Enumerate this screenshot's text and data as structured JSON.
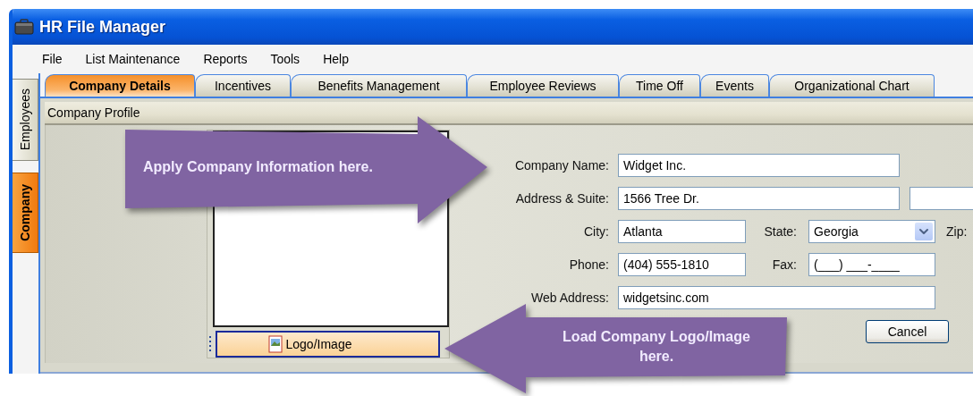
{
  "window": {
    "title": "HR File Manager"
  },
  "menu": [
    "File",
    "List Maintenance",
    "Reports",
    "Tools",
    "Help"
  ],
  "side_tabs": [
    {
      "label": "Employees",
      "selected": false
    },
    {
      "label": "Company",
      "selected": true
    }
  ],
  "tabs": [
    {
      "label": "Company Details",
      "selected": true
    },
    {
      "label": "Incentives",
      "selected": false
    },
    {
      "label": "Benefits Management",
      "selected": false
    },
    {
      "label": "Employee Reviews",
      "selected": false
    },
    {
      "label": "Time Off",
      "selected": false
    },
    {
      "label": "Events",
      "selected": false
    },
    {
      "label": "Organizational Chart",
      "selected": false
    }
  ],
  "section": {
    "title": "Company Profile"
  },
  "logo_button": {
    "label": "Logo/Image"
  },
  "form": {
    "company_name": {
      "label": "Company Name:",
      "value": "Widget Inc."
    },
    "address": {
      "label": "Address & Suite:",
      "value": "1566 Tree Dr."
    },
    "city": {
      "label": "City:",
      "value": "Atlanta"
    },
    "state": {
      "label": "State:",
      "value": "Georgia"
    },
    "zip": {
      "label": "Zip:"
    },
    "phone": {
      "label": "Phone:",
      "value": "(404) 555-1810"
    },
    "fax": {
      "label": "Fax:",
      "value": "(___) ___-____"
    },
    "web_address": {
      "label": "Web Address:",
      "value": "widgetsinc.com"
    },
    "cancel_button": "Cancel"
  },
  "callouts": [
    {
      "text": "Apply Company Information here.",
      "kind": "arrow-right"
    },
    {
      "text": "Load Company Logo/Image here.",
      "kind": "arrow-left"
    }
  ]
}
